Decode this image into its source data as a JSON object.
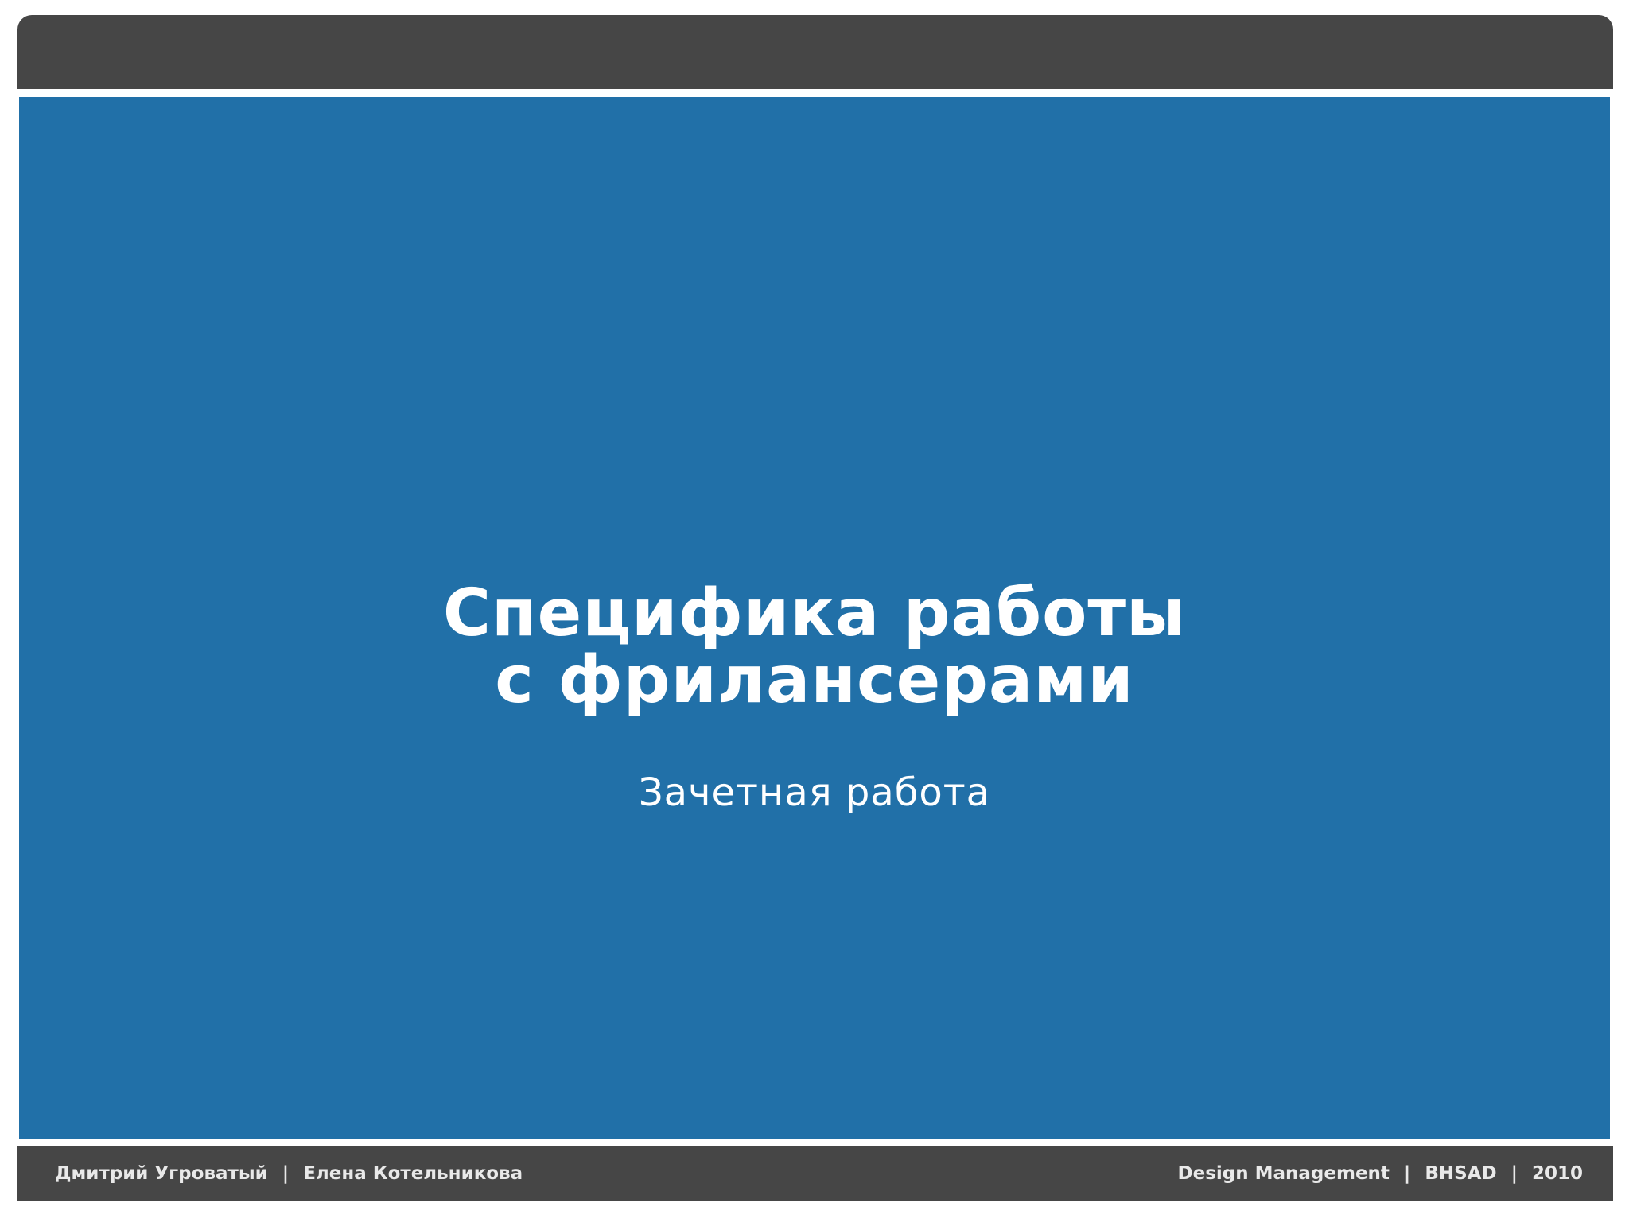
{
  "slide": {
    "title_lines": [
      "Специфика работы",
      "с фрилансерами"
    ],
    "subtitle": "Зачетная работа"
  },
  "footer": {
    "left": {
      "author1": "Дмитрий Угроватый",
      "separator": "|",
      "author2": "Елена Котельникова"
    },
    "right": {
      "course": "Design Management",
      "separator1": "|",
      "school": "BHSAD",
      "separator2": "|",
      "year": "2010"
    }
  },
  "colors": {
    "slide_background": "#2170a8",
    "bar_background": "#464646",
    "text": "#ffffff"
  }
}
